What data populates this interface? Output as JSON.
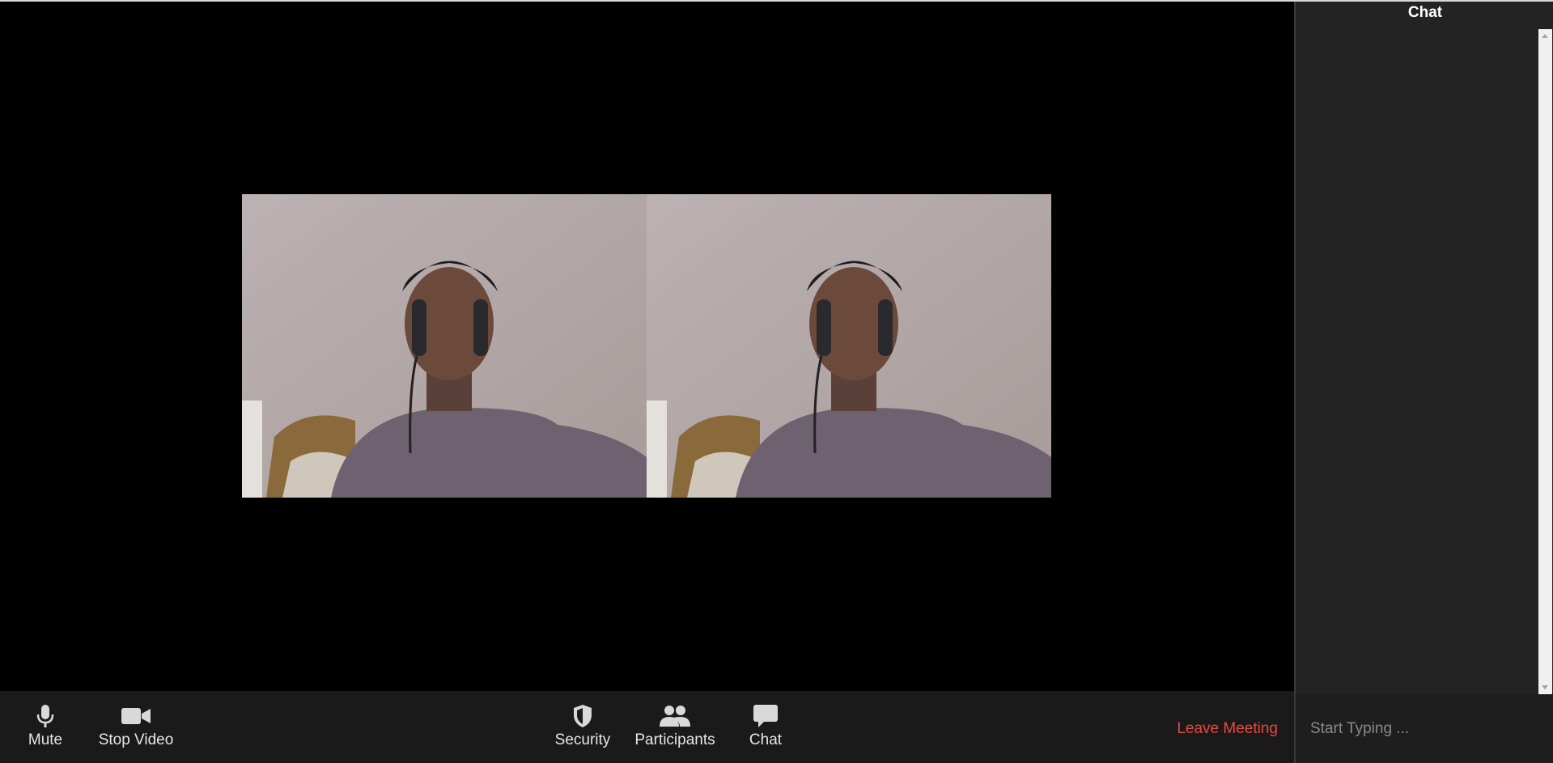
{
  "chat": {
    "title": "Chat",
    "input_placeholder": "Start Typing ..."
  },
  "toolbar": {
    "mute_label": "Mute",
    "mute_icon": "microphone-icon",
    "video_label": "Stop Video",
    "video_icon": "video-camera-icon",
    "security_label": "Security",
    "security_icon": "shield-icon",
    "participants_label": "Participants",
    "participants_icon": "participants-icon",
    "chat_label": "Chat",
    "chat_icon": "chat-bubble-icon",
    "leave_label": "Leave Meeting"
  },
  "colors": {
    "toolbar_bg": "#1a1a1a",
    "chat_bg": "#232323",
    "leave": "#e8473f",
    "stage_bg": "#000000"
  }
}
